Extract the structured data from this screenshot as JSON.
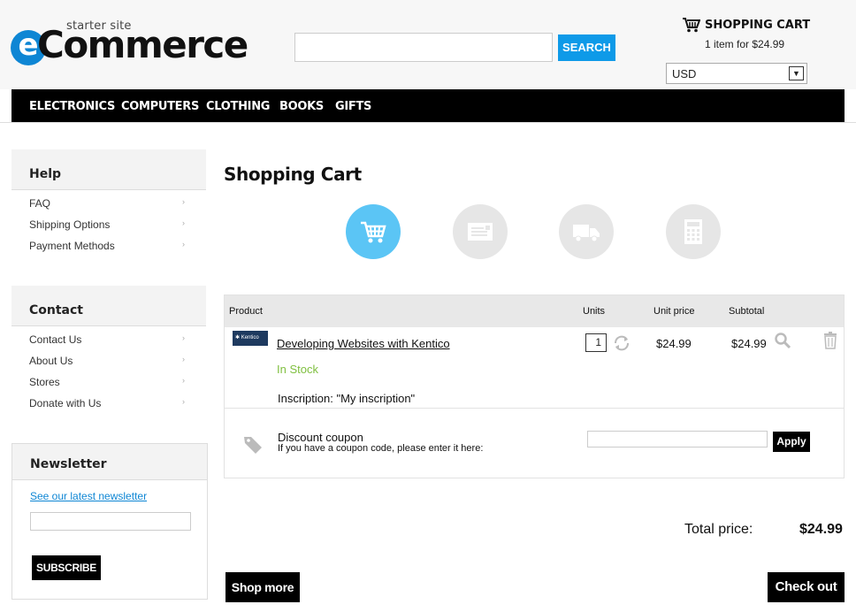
{
  "header": {
    "logo_small": "starter site",
    "logo_e": "e",
    "logo_main": "Commerce",
    "search_placeholder": "",
    "search_label": "SEARCH",
    "cart_title": "SHOPPING CART",
    "cart_summary": "1 item for $24.99",
    "currency": "USD"
  },
  "nav": {
    "items": [
      "ELECTRONICS",
      "COMPUTERS",
      "CLOTHING",
      "BOOKS",
      "GIFTS"
    ]
  },
  "sidebar": {
    "help": {
      "title": "Help",
      "links": [
        "FAQ",
        "Shipping Options",
        "Payment Methods"
      ]
    },
    "contact": {
      "title": "Contact",
      "links": [
        "Contact Us",
        "About Us",
        "Stores",
        "Donate with Us"
      ]
    },
    "newsletter": {
      "title": "Newsletter",
      "link": "See our latest newsletter",
      "email_value": "",
      "button": "SUBSCRIBE"
    }
  },
  "main": {
    "title": "Shopping Cart",
    "steps": [
      {
        "icon": "cart-icon",
        "active": true
      },
      {
        "icon": "address-card-icon",
        "active": false
      },
      {
        "icon": "truck-icon",
        "active": false
      },
      {
        "icon": "calculator-icon",
        "active": false
      }
    ],
    "table": {
      "headers": [
        "Product",
        "Units",
        "Unit price",
        "Subtotal"
      ],
      "item": {
        "thumb_text": "Kentico",
        "name": "Developing Websites with Kentico",
        "stock": "In Stock",
        "inscription": "Inscription: \"My inscription\"",
        "units": "1",
        "unit_price": "$24.99",
        "subtotal": "$24.99"
      },
      "coupon": {
        "title": "Discount coupon",
        "description": "If you have a coupon code, please enter it here:",
        "value": "",
        "button": "Apply"
      }
    },
    "total_label": "Total price:",
    "total_value": "$24.99",
    "shop_more": "Shop more",
    "checkout": "Check out"
  },
  "colors": {
    "accent": "#0e9ae8",
    "step_active": "#5bc5f5",
    "in_stock": "#7fbf3f"
  }
}
